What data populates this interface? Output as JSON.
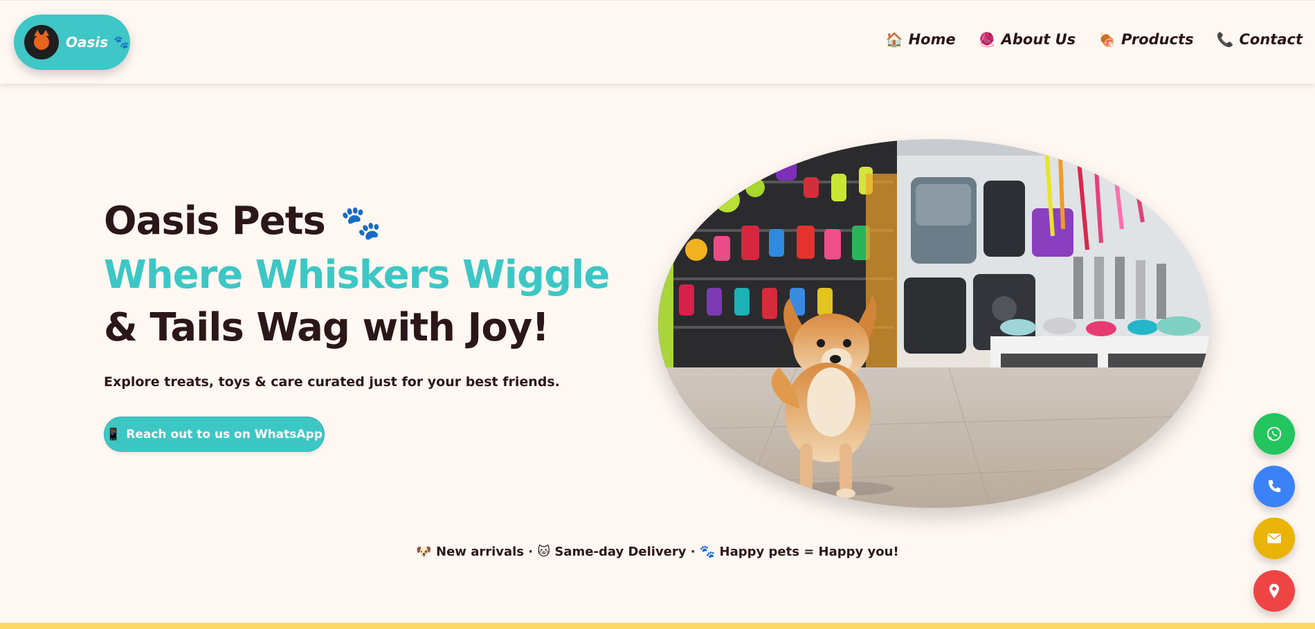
{
  "brand": {
    "name": "Oasis",
    "paw_glyph": "🐾",
    "logo_icon": "cat-logo-icon"
  },
  "nav": [
    {
      "icon": "🏠",
      "icon_name": "house-icon",
      "label": "Home"
    },
    {
      "icon": "🧶",
      "icon_name": "yarn-icon",
      "label": "About Us"
    },
    {
      "icon": "🍖",
      "icon_name": "meat-icon",
      "label": "Products"
    },
    {
      "icon": "📞",
      "icon_name": "phone-icon",
      "label": "Contact"
    }
  ],
  "hero": {
    "title_line1": "Oasis Pets",
    "title_paws": "🐾",
    "title_line2": "Where Whiskers Wiggle",
    "title_line3": "& Tails Wag with Joy!",
    "subtitle": "Explore treats, toys & care curated just for your best friends.",
    "cta_icon": "📱",
    "cta_label": "Reach out to us on WhatsApp"
  },
  "tagline": "🐶 New arrivals · 🐱 Same-day Delivery · 🐾 Happy pets = Happy you!",
  "fabs": [
    {
      "name": "whatsapp",
      "color": "#22c55e"
    },
    {
      "name": "call",
      "color": "#3b82f6"
    },
    {
      "name": "email",
      "color": "#eab308"
    },
    {
      "name": "location",
      "color": "#ef4444"
    }
  ],
  "colors": {
    "background": "#fff7f2",
    "accent_teal": "#3cc7c5",
    "text_dark": "#2b1718",
    "bottom_bar": "#fdd866"
  }
}
